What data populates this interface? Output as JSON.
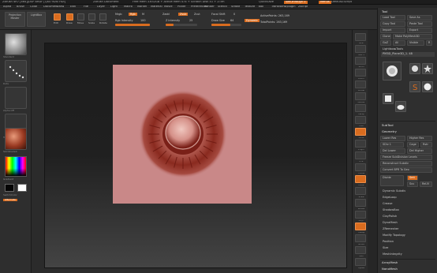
{
  "titlebar": {
    "app": "ZBrush 4R7 [x64][DSP 8HDF [QX0 9DI0 HDI]",
    "document": "ZBrush Document",
    "status": "Free Mem 3.652GB + Active Mem 474 + Scratch Disk 41 + ZTim",
    "quicksave": "QuickSave",
    "see_through": "See-through 0",
    "menus_btn": "Menus",
    "script_btn": "DefaultZScript"
  },
  "menubar": {
    "items": [
      "Alpha",
      "Brush",
      "Color",
      "Document",
      "Draw",
      "Edit",
      "File",
      "Layer",
      "Light",
      "Macro",
      "Marker",
      "Material",
      "Movie",
      "Picker",
      "Preferences",
      "Render",
      "Stencil",
      "Stroke",
      "Texture",
      "Tool",
      "Transform",
      "Zplugin",
      "Zscript"
    ]
  },
  "topshelf": {
    "projection_master": "Projection Master",
    "lightbox": "LightBox",
    "edit": "Edit",
    "draw": "Draw",
    "move": "Move",
    "scale": "Scale",
    "rotate": "Rotate",
    "mrgb": "Mrgb",
    "rgb": "Rgb",
    "m": "M",
    "rgb_intensity_label": "Rgb Intensity",
    "rgb_intensity_value": "100",
    "rgb_intensity": 1.0,
    "zadd": "Zadd",
    "zsub": "Zsub",
    "zcut": "Zcut",
    "z_intensity_label": "Z Intensity",
    "z_intensity_value": "25",
    "z_intensity": 0.25,
    "focal_shift_label": "Focal Shift",
    "focal_shift_value": "0",
    "draw_size_label": "Draw Size",
    "draw_size_value": "64",
    "draw_size": 0.64,
    "dynamic": "Dynamic",
    "active_points": "ActivePoints: 263,169",
    "total_points": "TotalPoints: 263,169"
  },
  "leftshelf": {
    "thumbs": [
      {
        "name": "brush-standard",
        "label": "Standard"
      },
      {
        "name": "stroke-dots",
        "label": "Dots"
      },
      {
        "name": "alpha-off",
        "label": "Alpha Off"
      },
      {
        "name": "texture-off",
        "label": "Texture Off"
      },
      {
        "name": "material",
        "label": "SkinShade4"
      }
    ],
    "gradient_label": "Gradient",
    "switch_color": "SwitchColor",
    "alternate": "Alternate",
    "swatch_fg": "#050505",
    "swatch_bg": "#ffffff"
  },
  "canvas": {
    "doc_color": "#c98888",
    "sculpt_color": "#8a2a1f"
  },
  "rtool1": {
    "labels": [
      "BPR",
      "SPix 3",
      "Scroll",
      "Zoom",
      "Actual",
      "AAHalf",
      "Persp",
      "Floor",
      "Local",
      "L.Sym",
      "XYZ",
      "Frame",
      "Move",
      "Scale",
      "Rotate",
      "PolyF",
      "Transp",
      "Ghost",
      "Solo",
      "Xpose"
    ]
  },
  "toolpalette": {
    "title": "Tool",
    "load_tool": "Load Tool",
    "save_as": "Save As",
    "copy_tool": "Copy Tool",
    "paste_tool": "Paste Tool",
    "import": "Import",
    "export": "Export",
    "clone": "Clone",
    "make_polymesh": "Make PolyMesh3D",
    "goz": "GoZ",
    "all": "All",
    "visible": "Visible",
    "r": "R",
    "lightbox_tools": "Lightbox▸Tools",
    "current_tool": "PM3D_Plane3D_1. 48",
    "r_label": "R",
    "brushes": [
      {
        "name": "plane3d-thumb",
        "label": "PM3D_Plane3D"
      },
      {
        "name": "cylinder3d-thumb",
        "label": "Cylinder3D"
      },
      {
        "name": "polymesh3d-thumb",
        "label": "PolyMesh3D"
      },
      {
        "name": "simplebrush-thumb",
        "label": "SimpleBrush"
      },
      {
        "name": "sphere3d-thumb",
        "label": "Sphere3D"
      },
      {
        "name": "plane-thumb",
        "label": "Plane3D"
      },
      {
        "name": "pm3d-plane-thumb",
        "label": "PM3D_Plane"
      }
    ],
    "subtool": "SubTool",
    "geometry": "Geometry",
    "lower_res": "Lower Res",
    "higher_res": "Higher Res",
    "sdiv_label": "SDiv",
    "sdiv_value": "1",
    "sdiv": 0.2,
    "cage": "Cage",
    "rstr": "Rstr",
    "del_lower": "Del Lower",
    "del_higher": "Del Higher",
    "freeze_subdiv": "Freeze SubDivision Levels",
    "reconstruct_subdiv": "Reconstruct Subdiv",
    "convert_bpr": "Convert BPR To Geo",
    "divide": "Divide",
    "smt": "Smt",
    "suv": "Suv",
    "reuv": "ReUV",
    "sections": [
      "Dynamic Subdiv",
      "EdgeLoop",
      "Crease",
      "ShadowBox",
      "ClayPolish",
      "DynaMesh",
      "ZRemesher",
      "Modify Topology",
      "Position",
      "Size",
      "MeshIntegrity"
    ],
    "bottom": [
      "ArrayMesh",
      "NanoMesh"
    ]
  }
}
